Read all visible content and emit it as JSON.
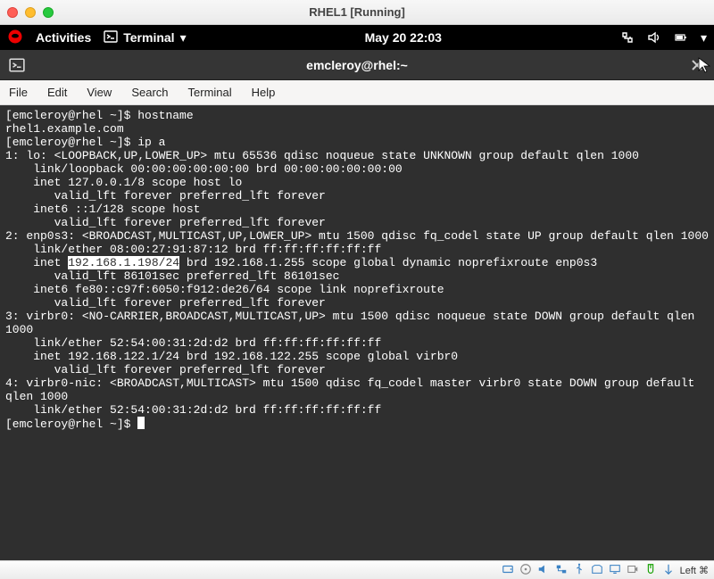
{
  "window": {
    "title": "RHEL1 [Running]"
  },
  "gnome": {
    "activities": "Activities",
    "app_name": "Terminal",
    "clock": "May 20  22:03",
    "tray": {
      "network": "network-icon",
      "volume": "volume-icon",
      "battery": "battery-icon"
    }
  },
  "term_window_title": "emcleroy@rhel:~",
  "menubar": {
    "file": "File",
    "edit": "Edit",
    "view": "View",
    "search": "Search",
    "terminal": "Terminal",
    "help": "Help"
  },
  "terminal_lines": [
    {
      "prompt": "[emcleroy@rhel ~]$ ",
      "cmd": "hostname"
    },
    "rhel1.example.com",
    {
      "prompt": "[emcleroy@rhel ~]$ ",
      "cmd": "ip a"
    },
    "1: lo: <LOOPBACK,UP,LOWER_UP> mtu 65536 qdisc noqueue state UNKNOWN group default qlen 1000",
    "    link/loopback 00:00:00:00:00:00 brd 00:00:00:00:00:00",
    "    inet 127.0.0.1/8 scope host lo",
    "       valid_lft forever preferred_lft forever",
    "    inet6 ::1/128 scope host",
    "       valid_lft forever preferred_lft forever",
    "2: enp0s3: <BROADCAST,MULTICAST,UP,LOWER_UP> mtu 1500 qdisc fq_codel state UP group default qlen 1000",
    "    link/ether 08:00:27:91:87:12 brd ff:ff:ff:ff:ff:ff",
    {
      "pre": "    inet ",
      "hl": "192.168.1.198/24",
      "post": " brd 192.168.1.255 scope global dynamic noprefixroute enp0s3"
    },
    "       valid_lft 86101sec preferred_lft 86101sec",
    "    inet6 fe80::c97f:6050:f912:de26/64 scope link noprefixroute",
    "       valid_lft forever preferred_lft forever",
    "3: virbr0: <NO-CARRIER,BROADCAST,MULTICAST,UP> mtu 1500 qdisc noqueue state DOWN group default qlen 1000",
    "    link/ether 52:54:00:31:2d:d2 brd ff:ff:ff:ff:ff:ff",
    "    inet 192.168.122.1/24 brd 192.168.122.255 scope global virbr0",
    "       valid_lft forever preferred_lft forever",
    "4: virbr0-nic: <BROADCAST,MULTICAST> mtu 1500 qdisc fq_codel master virbr0 state DOWN group default qlen 1000",
    "    link/ether 52:54:00:31:2d:d2 brd ff:ff:ff:ff:ff:ff",
    {
      "prompt": "[emcleroy@rhel ~]$ ",
      "cursor": true
    }
  ],
  "bottombar": {
    "host_key": "Left ⌘"
  }
}
